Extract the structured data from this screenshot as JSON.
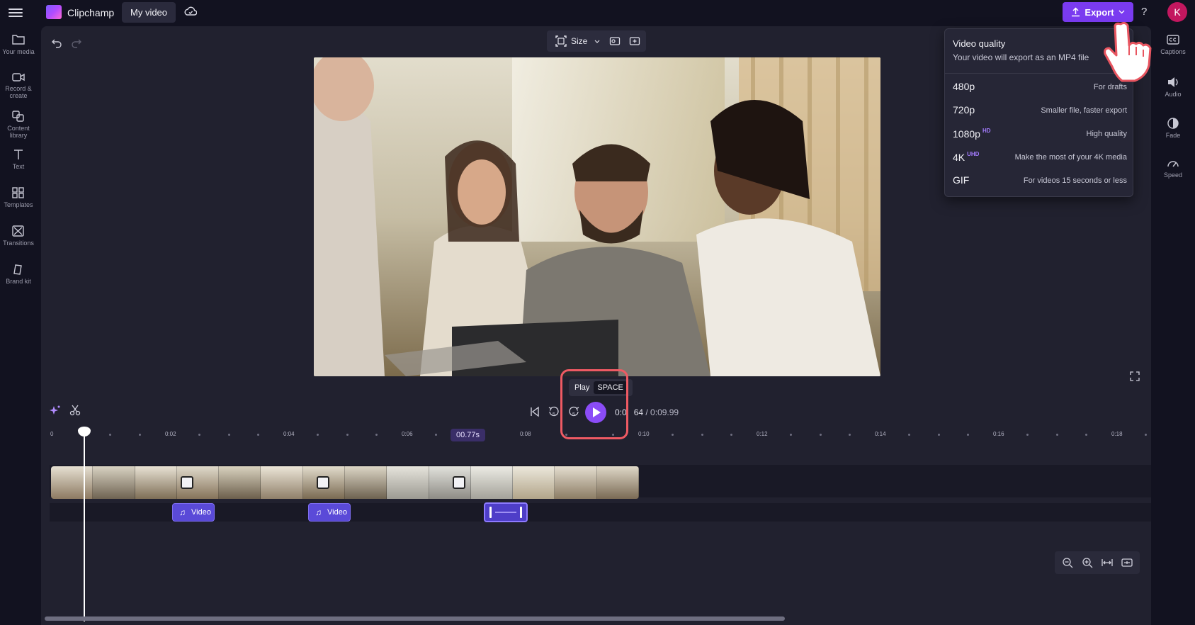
{
  "app": {
    "name": "Clipchamp",
    "project_tab": "My video",
    "avatar_initial": "K",
    "help": "?"
  },
  "header": {
    "export_label": "Export"
  },
  "left_rail": {
    "items": [
      {
        "label": "Your media",
        "icon": "folder-icon"
      },
      {
        "label": "Record &\ncreate",
        "icon": "camera-icon"
      },
      {
        "label": "Content\nlibrary",
        "icon": "library-icon"
      },
      {
        "label": "Text",
        "icon": "text-icon"
      },
      {
        "label": "Templates",
        "icon": "templates-icon"
      },
      {
        "label": "Transitions",
        "icon": "transitions-icon"
      },
      {
        "label": "Brand kit",
        "icon": "brand-kit-icon"
      }
    ]
  },
  "right_rail": {
    "items": [
      {
        "label": "Captions",
        "icon": "captions-icon"
      },
      {
        "label": "Audio",
        "icon": "audio-icon"
      },
      {
        "label": "Fade",
        "icon": "fade-icon"
      },
      {
        "label": "Speed",
        "icon": "speed-icon"
      }
    ]
  },
  "preview_toolbar": {
    "size_label": "Size"
  },
  "playback": {
    "current_time": "0:0",
    "current_time_tail": "64",
    "total_time": "/ 0:09.99",
    "tooltip_label": "Play",
    "tooltip_key": "SPACE",
    "rewind_label": "5",
    "forward_label": "5"
  },
  "timeline": {
    "ruler_labels": [
      "0",
      "0:02",
      "0:04",
      "0:06",
      "0:08",
      "0:10",
      "0:12",
      "0:14",
      "0:16",
      "0:18"
    ],
    "playhead_time": "00.77s",
    "audio_clips": [
      {
        "label": "Video"
      },
      {
        "label": "Video"
      }
    ]
  },
  "export_menu": {
    "title": "Video quality",
    "subtitle": "Your video will export as an MP4 file",
    "options": [
      {
        "label": "480p",
        "badge": "",
        "description": "For drafts"
      },
      {
        "label": "720p",
        "badge": "",
        "description": "Smaller file, faster export"
      },
      {
        "label": "1080p",
        "badge": "HD",
        "description": "High quality"
      },
      {
        "label": "4K",
        "badge": "UHD",
        "description": "Make the most of your 4K media"
      },
      {
        "label": "GIF",
        "badge": "",
        "description": "For videos 15 seconds or less"
      }
    ]
  },
  "colors": {
    "accent": "#7a3bf0",
    "highlight": "#ef5a63",
    "audio_clip": "#5a4ad8",
    "background": "#121220",
    "panel": "#21212f"
  }
}
